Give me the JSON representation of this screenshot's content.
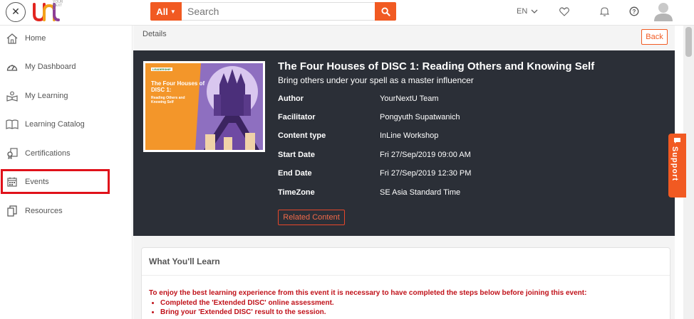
{
  "topbar": {
    "close_icon": "close-icon",
    "logo_subtext": "YOUR NEXT U",
    "search": {
      "category": "All",
      "placeholder": "Search"
    },
    "language": "EN",
    "accent_color": "#f15a22"
  },
  "sidebar": {
    "items": [
      {
        "label": "Home",
        "icon": "home-icon"
      },
      {
        "label": "My Dashboard",
        "icon": "dashboard-icon"
      },
      {
        "label": "My Learning",
        "icon": "learning-icon"
      },
      {
        "label": "Learning Catalog",
        "icon": "book-icon"
      },
      {
        "label": "Certifications",
        "icon": "certificate-icon"
      },
      {
        "label": "Events",
        "icon": "calendar-icon"
      },
      {
        "label": "Resources",
        "icon": "resources-icon"
      }
    ]
  },
  "main": {
    "breadcrumb": "Details",
    "back_label": "Back",
    "thumbnail": {
      "badge": "LEADERSHIP",
      "title": "The Four Houses of DISC 1:",
      "subtitle": "Reading Others and Knowing Self"
    },
    "title": "The Four Houses of DISC 1: Reading Others and Knowing Self",
    "subtitle": "Bring others under your spell as a master influencer",
    "meta": [
      {
        "label": "Author",
        "value": "YourNextU Team"
      },
      {
        "label": "Facilitator",
        "value": "Pongyuth Supatwanich"
      },
      {
        "label": "Content type",
        "value": "InLine Workshop"
      },
      {
        "label": "Start Date",
        "value": "Fri 27/Sep/2019 09:00 AM"
      },
      {
        "label": "End Date",
        "value": "Fri 27/Sep/2019 12:30 PM"
      },
      {
        "label": "TimeZone",
        "value": "SE Asia Standard Time"
      }
    ],
    "related_label": "Related Content",
    "learn": {
      "title": "What You'll Learn",
      "note": "To enjoy the best learning experience from this event it is necessary to have completed the steps below before joining this event:",
      "steps": [
        "Completed the 'Extended DISC' online assessment.",
        "Bring your 'Extended DISC' result to the session."
      ]
    }
  },
  "support_label": "Support"
}
